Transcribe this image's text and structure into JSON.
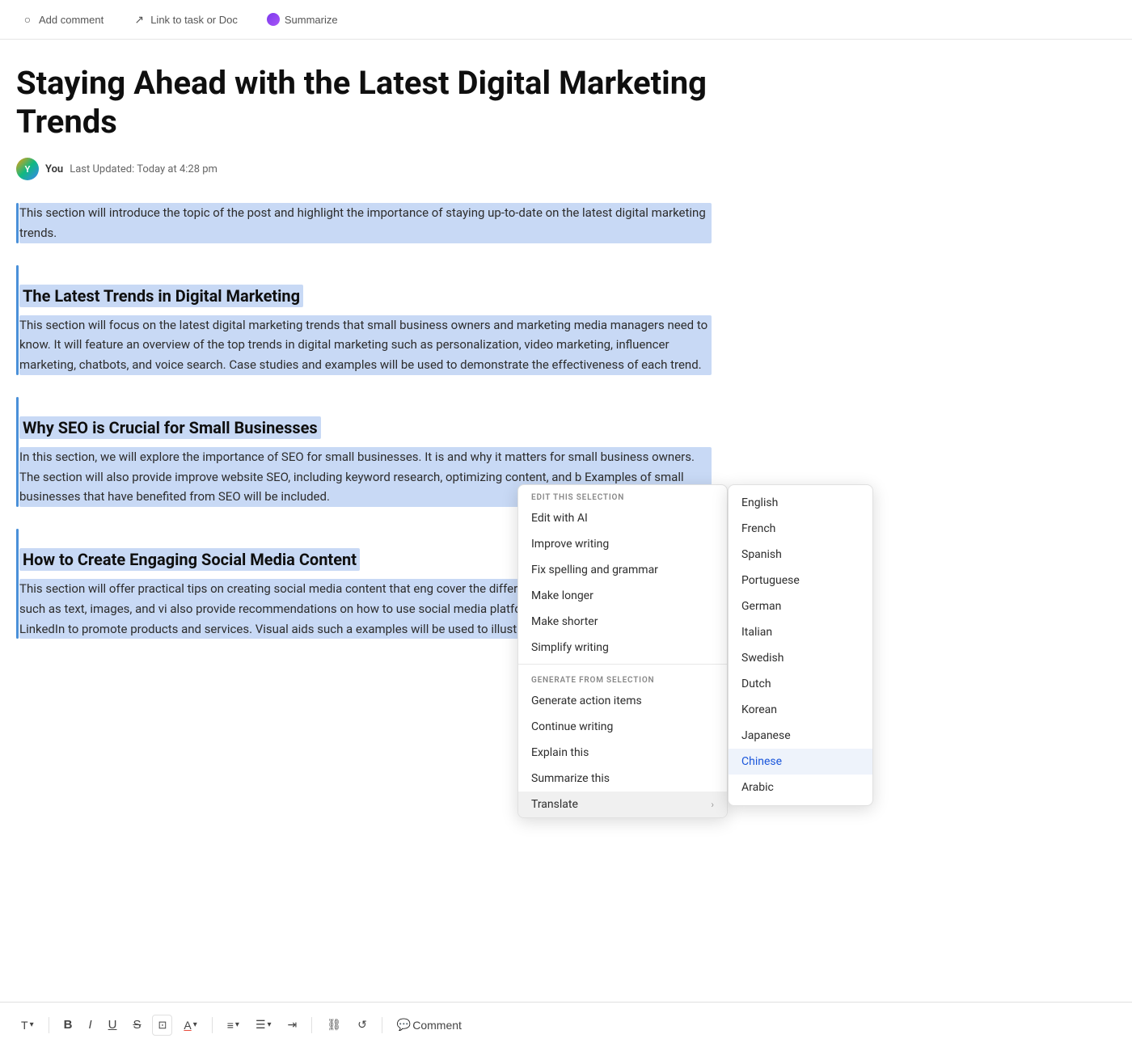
{
  "toolbar": {
    "add_comment": "Add comment",
    "link_to_task": "Link to task or Doc",
    "summarize": "Summarize"
  },
  "document": {
    "title": "Staying Ahead with the Latest Digital Marketing Trends",
    "author": "You",
    "last_updated": "Last Updated: Today at 4:28 pm",
    "sections": [
      {
        "id": "intro",
        "heading": null,
        "content": "This section will introduce the topic of the post and highlight the importance of staying up-to-date on the latest digital marketing trends.",
        "selected": true
      },
      {
        "id": "trends",
        "heading": "The Latest Trends in Digital Marketing",
        "content": "This section will focus on the latest digital marketing trends that small business owners and marketing media managers need to know. It will feature an overview of the top trends in digital marketing such as personalization, video marketing, influencer marketing, chatbots, and voice search. Case studies and examples will be used to demonstrate the effectiveness of each trend.",
        "selected": true
      },
      {
        "id": "seo",
        "heading": "Why SEO is Crucial for Small Businesses",
        "content": "In this section, we will explore the importance of SEO for small businesses. It is and why it matters for small business owners. The section will also provide improve website SEO, including keyword research, optimizing content, and b Examples of small businesses that have benefited from SEO will be included.",
        "selected": true
      },
      {
        "id": "social",
        "heading": "How to Create Engaging Social Media Content",
        "content": "This section will offer practical tips on creating social media content that eng cover the different types of social media content such as text, images, and vi also provide recommendations on how to use social media platforms like Fac Instagram, and LinkedIn to promote products and services. Visual aids such a examples will be used to illustrate the best practices.",
        "selected": true
      }
    ]
  },
  "context_menu": {
    "edit_section_label": "EDIT THIS SELECTION",
    "edit_with_ai": "Edit with AI",
    "improve_writing": "Improve writing",
    "fix_spelling": "Fix spelling and grammar",
    "make_longer": "Make longer",
    "make_shorter": "Make shorter",
    "simplify_writing": "Simplify writing",
    "generate_section_label": "GENERATE FROM SELECTION",
    "generate_action_items": "Generate action items",
    "continue_writing": "Continue writing",
    "explain_this": "Explain this",
    "summarize_this": "Summarize this",
    "translate": "Translate",
    "translate_chevron": "›"
  },
  "language_submenu": {
    "languages": [
      {
        "id": "english",
        "label": "English"
      },
      {
        "id": "french",
        "label": "French"
      },
      {
        "id": "spanish",
        "label": "Spanish"
      },
      {
        "id": "portuguese",
        "label": "Portuguese"
      },
      {
        "id": "german",
        "label": "German"
      },
      {
        "id": "italian",
        "label": "Italian"
      },
      {
        "id": "swedish",
        "label": "Swedish"
      },
      {
        "id": "dutch",
        "label": "Dutch"
      },
      {
        "id": "korean",
        "label": "Korean"
      },
      {
        "id": "japanese",
        "label": "Japanese"
      },
      {
        "id": "chinese",
        "label": "Chinese",
        "selected": true
      },
      {
        "id": "arabic",
        "label": "Arabic"
      }
    ]
  },
  "format_toolbar": {
    "text": "T",
    "bold": "B",
    "italic": "I",
    "underline": "U",
    "strikethrough": "S",
    "highlight": "⊡",
    "font_color": "A",
    "align": "≡",
    "list": "≡",
    "indent": "⇥",
    "link": "⛓",
    "undo": "↺",
    "comment": "Comment"
  },
  "colors": {
    "selection_bg": "#c8d9f5",
    "accent_blue": "#4a90d9",
    "menu_shadow": "rgba(0,0,0,0.15)"
  }
}
